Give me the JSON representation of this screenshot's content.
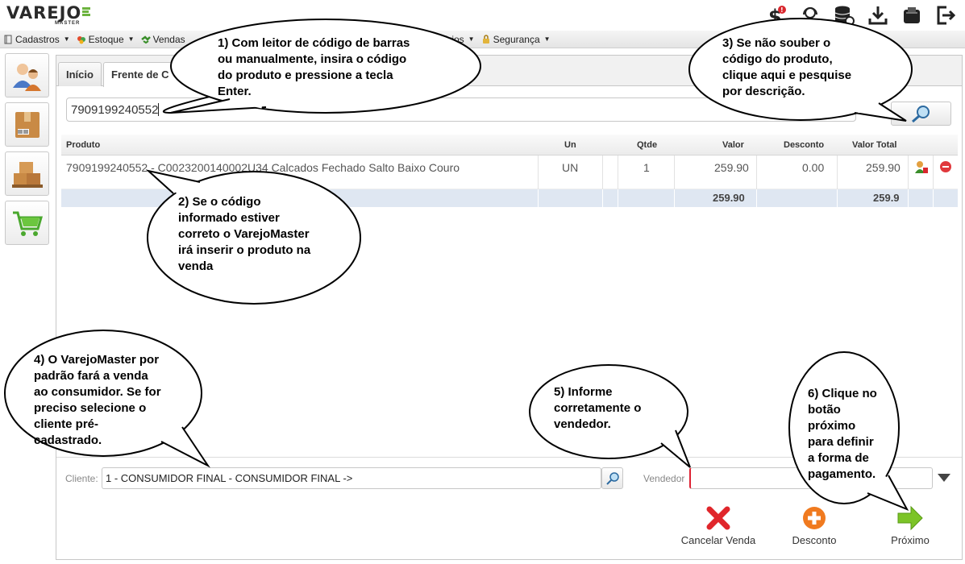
{
  "header": {
    "logo_text": "VAREJO",
    "logo_sub": "MASTER",
    "icons": [
      "dollar-alert-icon",
      "support-agent-icon",
      "database-settings-icon",
      "download-icon",
      "printer-icon",
      "logout-icon"
    ]
  },
  "menu": {
    "items": [
      {
        "label": "Cadastros",
        "icon": "book-icon"
      },
      {
        "label": "Estoque",
        "icon": "boxes-icon"
      },
      {
        "label": "Vendas",
        "icon": "handshake-icon"
      },
      {
        "label": "Relatórios",
        "icon": "report-icon"
      },
      {
        "label": "Segurança",
        "icon": "lock-icon"
      }
    ]
  },
  "launcher": [
    "customers-icon",
    "product-box-icon",
    "stock-boxes-icon",
    "shopping-cart-icon"
  ],
  "tabs": [
    {
      "label": "Início"
    },
    {
      "label": "Frente de C"
    }
  ],
  "search": {
    "value": "7909199240552"
  },
  "grid": {
    "headers": {
      "produto": "Produto",
      "un": "Un",
      "qtde": "Qtde",
      "valor": "Valor",
      "desconto": "Desconto",
      "valor_total": "Valor Total"
    },
    "rows": [
      {
        "produto": "7909199240552 - C0023200140002U34 Calcados Fechado Salto Baixo Couro",
        "un": "UN",
        "qtde": "1",
        "valor": "259.90",
        "desconto": "0.00",
        "valor_total": "259.90"
      }
    ],
    "totals": {
      "valor": "259.90",
      "valor_total": "259.9"
    }
  },
  "footer": {
    "cliente_label": "Cliente:",
    "cliente_value": "1 - CONSUMIDOR FINAL - CONSUMIDOR FINAL ->",
    "vendedor_label": "Vendedor",
    "vendedor_value": ""
  },
  "actions": {
    "cancel_label": "Cancelar Venda",
    "discount_label": "Desconto",
    "next_label": "Próximo"
  },
  "callouts": {
    "c1": [
      "1) Com leitor de código de barras",
      "ou manualmente, insira o código",
      "do produto e pressione a tecla",
      "Enter."
    ],
    "c2": [
      "2) Se o código",
      "informado estiver",
      "correto o VarejoMaster",
      "irá inserir o produto na",
      "venda"
    ],
    "c3": [
      "3) Se não souber o",
      "código do produto,",
      "clique aqui e pesquise",
      "por descrição."
    ],
    "c4": [
      "4) O VarejoMaster por",
      "padrão fará a venda",
      "ao consumidor. Se for",
      "preciso selecione o",
      "cliente pré-",
      "cadastrado."
    ],
    "c5": [
      "5) Informe",
      "corretamente o",
      "vendedor."
    ],
    "c6": [
      "6) Clique no",
      "botão",
      "próximo",
      "para definir",
      "a forma de",
      "pagamento."
    ]
  },
  "colors": {
    "logo_green": "#6cb33e",
    "total_row": "#dfe7f2",
    "required_border": "#dd2233",
    "cancel_red": "#e0262b",
    "discount_orange": "#f07a1f",
    "next_green": "#7cc427"
  }
}
